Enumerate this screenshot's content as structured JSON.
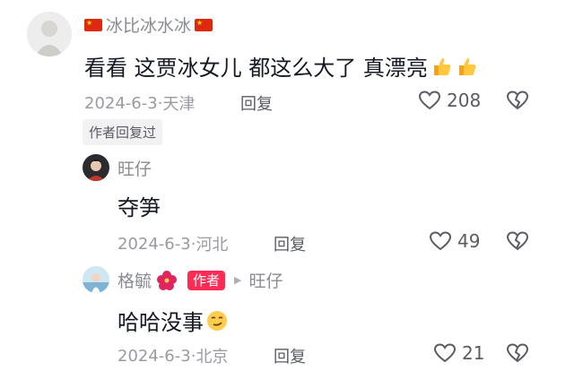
{
  "comment": {
    "username": "冰比冰水冰",
    "text": "看看 这贾冰女儿 都这么大了 真漂亮",
    "date": "2024-6-3",
    "location": "天津",
    "reply_label": "回复",
    "likes": "208",
    "author_replied": "作者回复过"
  },
  "replies": [
    {
      "username": "旺仔",
      "text": "夺笋",
      "date": "2024-6-3",
      "location": "河北",
      "reply_label": "回复",
      "likes": "49"
    },
    {
      "username": "格毓",
      "author_badge": "作者",
      "reply_to": "旺仔",
      "text": "哈哈没事",
      "date": "2024-6-3",
      "location": "北京",
      "reply_label": "回复",
      "likes": "21"
    }
  ],
  "separator": "·",
  "colors": {
    "badge": "#fe2c55",
    "flag": "#de2910"
  }
}
